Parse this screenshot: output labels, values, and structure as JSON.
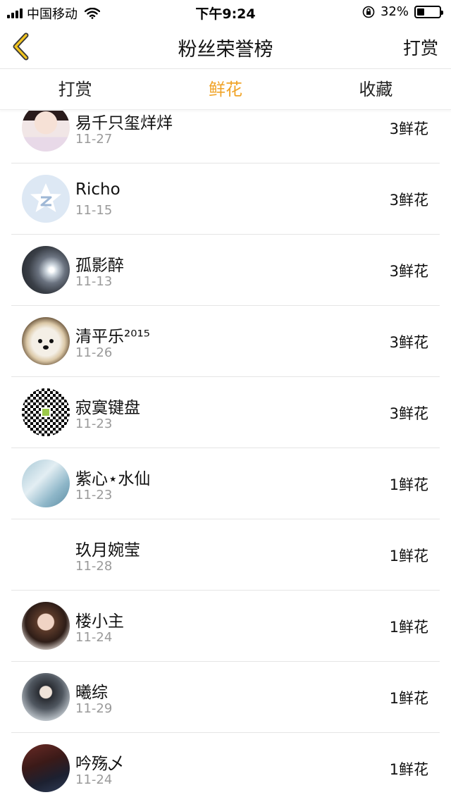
{
  "status_bar": {
    "carrier": "中国移动",
    "time": "下午9:24",
    "battery_percent": "32%",
    "battery_level": 0.32
  },
  "nav": {
    "title": "粉丝荣誉榜",
    "right_action": "打赏",
    "back_icon": "chevron-left-icon",
    "accent_color": "#f0a429"
  },
  "tabs": [
    {
      "label": "打赏",
      "active": false
    },
    {
      "label": "鲜花",
      "active": true
    },
    {
      "label": "收藏",
      "active": false
    }
  ],
  "list": [
    {
      "name": "易千只玺烊烊",
      "date": "11-27",
      "amount": "3鲜花",
      "avatar": "girl-illustration"
    },
    {
      "name": "Richo",
      "date": "11-15",
      "amount": "3鲜花",
      "avatar": "qq-default-avatar"
    },
    {
      "name": "孤影醉",
      "date": "11-13",
      "amount": "3鲜花",
      "avatar": "tunnel-photo"
    },
    {
      "name": "清平乐²⁰¹⁵",
      "date": "11-26",
      "amount": "3鲜花",
      "avatar": "dog-photo"
    },
    {
      "name": "寂寞键盘",
      "date": "11-23",
      "amount": "3鲜花",
      "avatar": "qr-code"
    },
    {
      "name": "紫心⋆水仙",
      "date": "11-23",
      "amount": "1鲜花",
      "avatar": "fairy-illustration"
    },
    {
      "name": "玖月婉莹",
      "date": "11-28",
      "amount": "1鲜花",
      "avatar": "empty"
    },
    {
      "name": "楼小主",
      "date": "11-24",
      "amount": "1鲜花",
      "avatar": "lady-photo"
    },
    {
      "name": "曦综",
      "date": "11-29",
      "amount": "1鲜花",
      "avatar": "costume-photo"
    },
    {
      "name": "吟殇乄",
      "date": "11-24",
      "amount": "1鲜花",
      "avatar": "guqin-photo"
    }
  ]
}
